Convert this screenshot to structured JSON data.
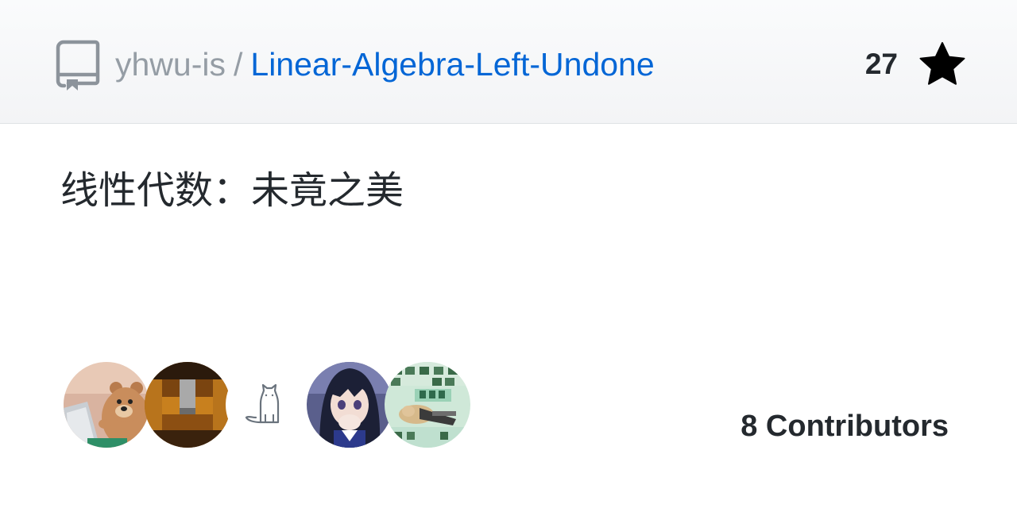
{
  "repo": {
    "owner": "yhwu-is",
    "separator": "/",
    "name": "Linear-Algebra-Left-Undone",
    "description": "线性代数：未竟之美"
  },
  "stars": {
    "count": "27",
    "icon": "star-icon"
  },
  "contributors": {
    "label": "8 Contributors",
    "avatars": [
      {
        "icon": "bear-avatar"
      },
      {
        "icon": "pixel-avatar"
      },
      {
        "icon": "cat-avatar"
      },
      {
        "icon": "anime-girl-avatar"
      },
      {
        "icon": "meme-avatar"
      }
    ]
  },
  "colors": {
    "link": "#0366d6",
    "muted": "#959da5",
    "text": "#24292e"
  }
}
